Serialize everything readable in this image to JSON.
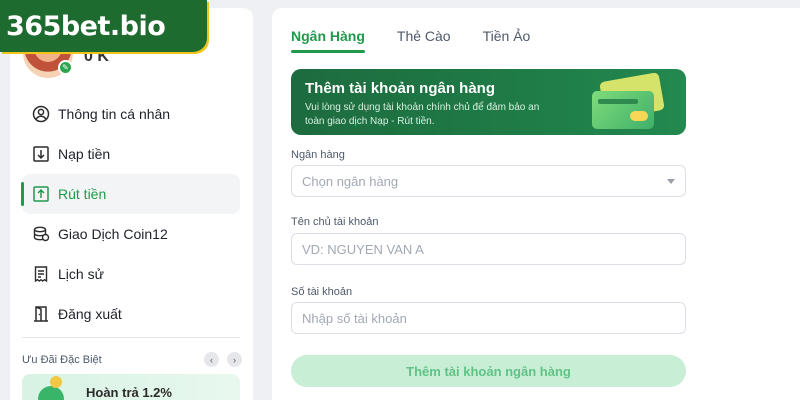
{
  "logo": {
    "text": "365bet.bio"
  },
  "profile": {
    "balance": "0 K"
  },
  "sidebar": {
    "items": [
      {
        "label": "Thông tin cá nhân",
        "icon": "user-circle-icon"
      },
      {
        "label": "Nạp tiền",
        "icon": "download-icon"
      },
      {
        "label": "Rút tiền",
        "icon": "upload-icon",
        "active": true
      },
      {
        "label": "Giao Dịch Coin12",
        "icon": "coins-icon"
      },
      {
        "label": "Lịch sử",
        "icon": "receipt-icon"
      },
      {
        "label": "Đăng xuất",
        "icon": "door-exit-icon"
      }
    ],
    "promo_title": "Ưu Đãi Đặc Biệt",
    "promo_card_text": "Hoàn trả 1.2%"
  },
  "main": {
    "tabs": [
      {
        "label": "Ngân Hàng",
        "active": true
      },
      {
        "label": "Thẻ Cào"
      },
      {
        "label": "Tiền Ảo"
      }
    ],
    "banner": {
      "title": "Thêm tài khoản ngân hàng",
      "description": "Vui lòng sử dụng tài khoản chính chủ để đảm bảo an toàn giao dịch Nạp - Rút tiền."
    },
    "form": {
      "bank_label": "Ngân hàng",
      "bank_placeholder": "Chọn ngân hàng",
      "holder_label": "Tên chủ tài khoản",
      "holder_placeholder": "VD: NGUYEN VAN A",
      "account_label": "Số tài khoản",
      "account_placeholder": "Nhập số tài khoản",
      "submit_label": "Thêm tài khoản ngân hàng"
    }
  },
  "colors": {
    "accent": "#1f9a4c",
    "banner_bg": "#1f7c47",
    "button_disabled_bg": "#c9eed6"
  }
}
